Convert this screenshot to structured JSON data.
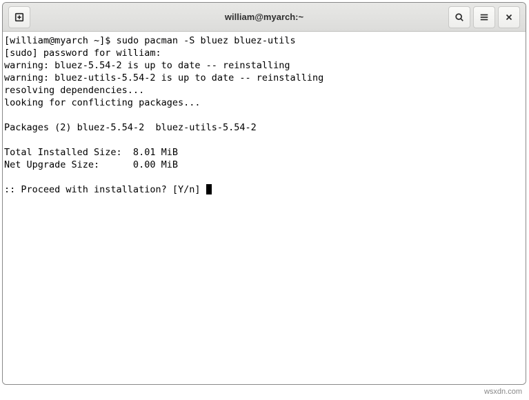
{
  "window": {
    "title": "william@myarch:~"
  },
  "terminal": {
    "prompt": "[william@myarch ~]$ ",
    "command": "sudo pacman -S bluez bluez-utils",
    "lines": [
      "[sudo] password for william:",
      "warning: bluez-5.54-2 is up to date -- reinstalling",
      "warning: bluez-utils-5.54-2 is up to date -- reinstalling",
      "resolving dependencies...",
      "looking for conflicting packages...",
      "",
      "Packages (2) bluez-5.54-2  bluez-utils-5.54-2",
      "",
      "Total Installed Size:  8.01 MiB",
      "Net Upgrade Size:      0.00 MiB",
      ""
    ],
    "prompt2": ":: Proceed with installation? [Y/n] "
  },
  "watermark": "wsxdn.com"
}
